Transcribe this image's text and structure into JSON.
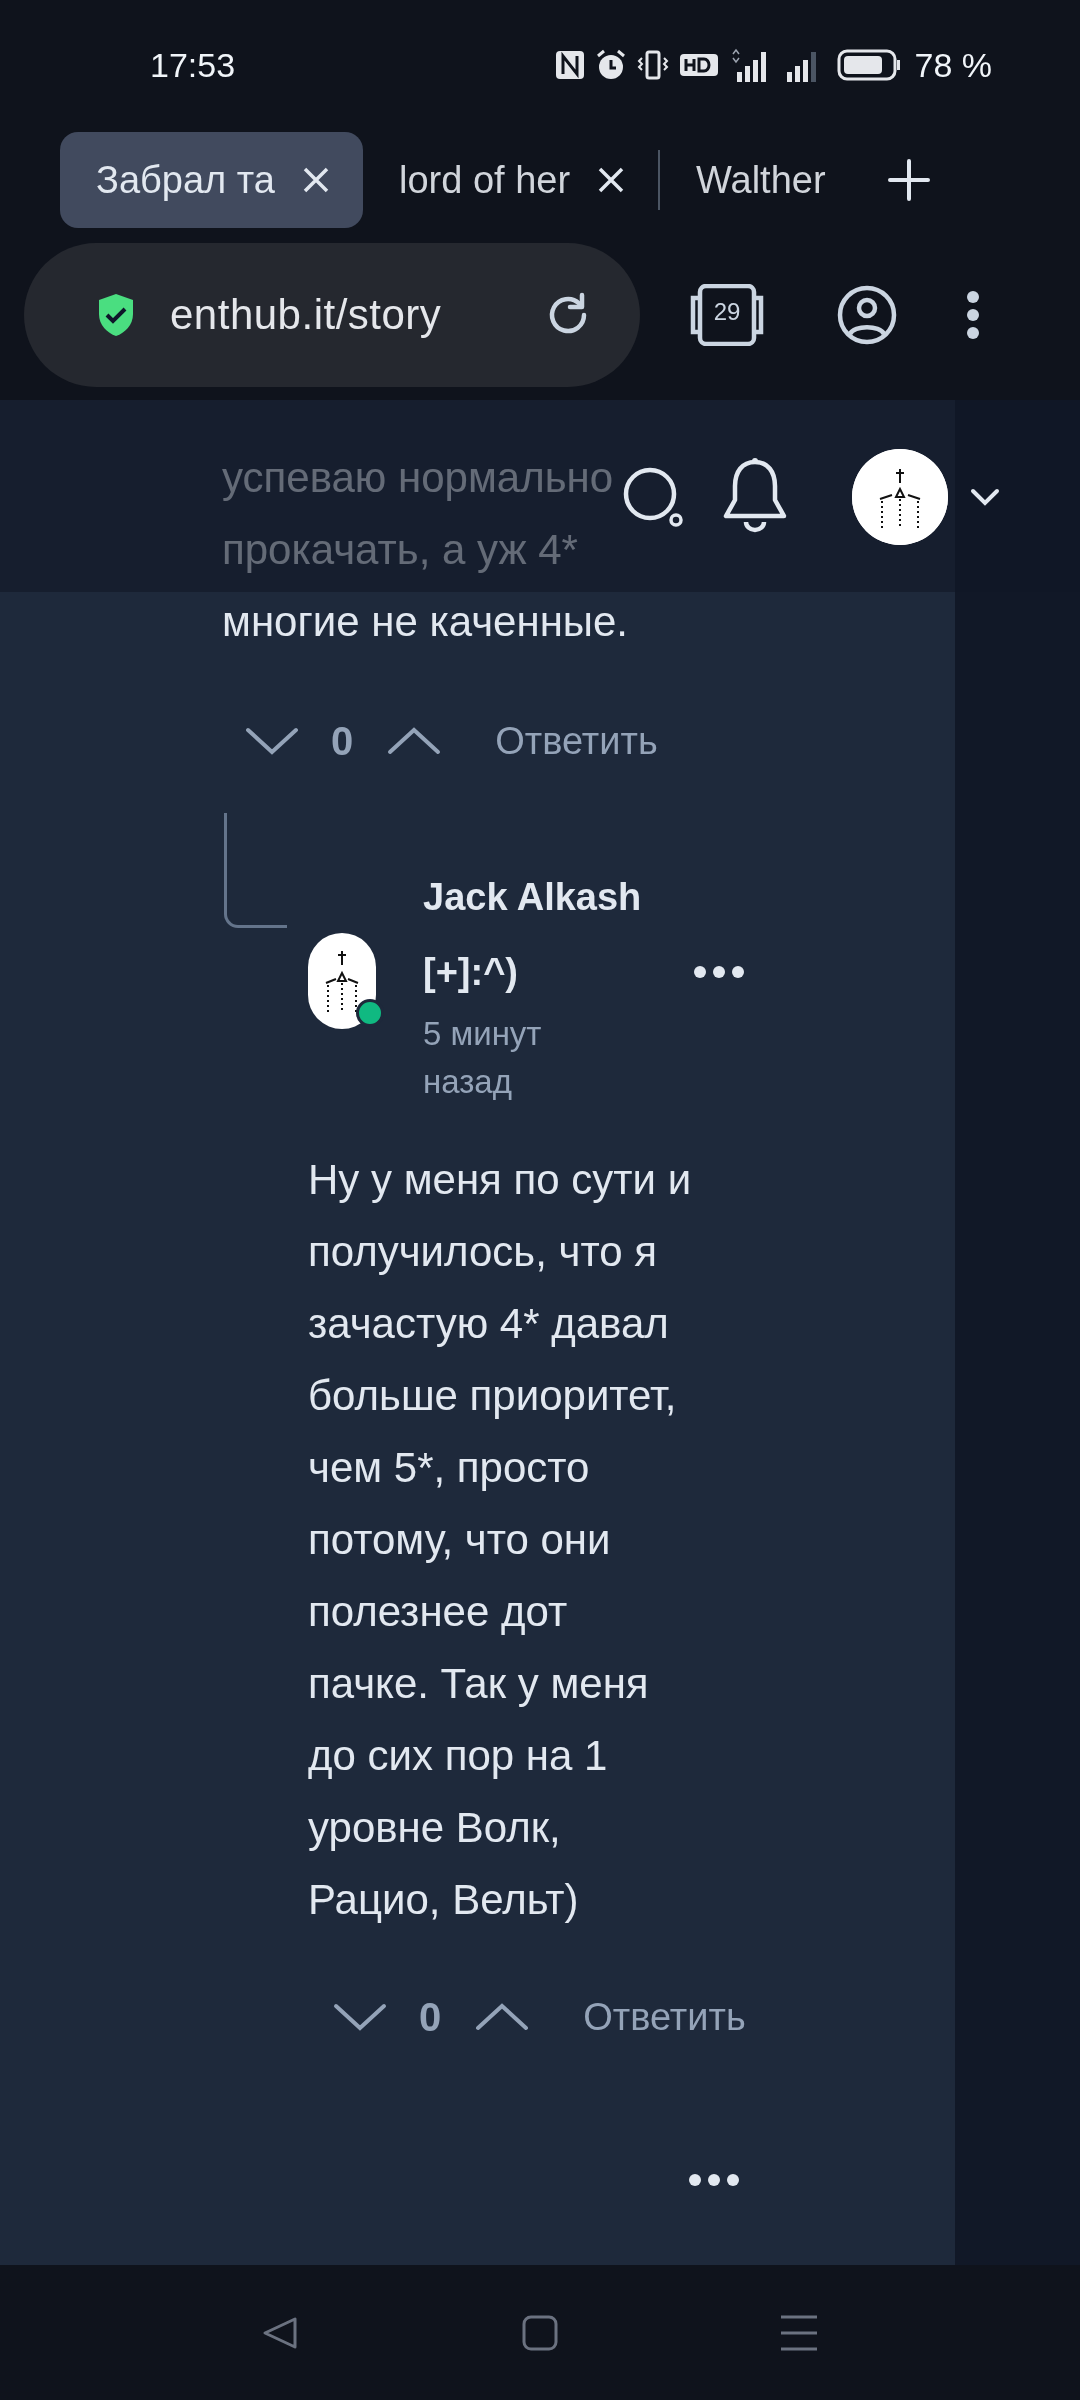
{
  "status_bar": {
    "time": "17:53",
    "battery": "78 %"
  },
  "tabs": [
    {
      "title": "Забрал та",
      "selected": true,
      "closable": true
    },
    {
      "title": "lord of her",
      "selected": false,
      "closable": true
    },
    {
      "title": "Walther",
      "selected": false,
      "closable": false
    }
  ],
  "address_bar": {
    "url": "enthub.it/story",
    "secure": true
  },
  "tab_count": "29",
  "previous_comment": {
    "text_lines": [
      "успеваю нормально",
      "прокачать, а уж 4*",
      "многие не каченные."
    ],
    "score": "0",
    "reply_label": "Ответить"
  },
  "reply": {
    "author": "Jack Alkash [+]:^)",
    "time": "5 минут назад",
    "online": true,
    "body": "Ну у меня по сути и получилось, что я зачастую 4* давал больше приоритет, чем 5*, просто потому, что они полезнее дот пачке. Так у меня до сих пор на 1 уровне Волк, Рацио, Вельт)",
    "score": "0",
    "reply_label": "Ответить"
  }
}
